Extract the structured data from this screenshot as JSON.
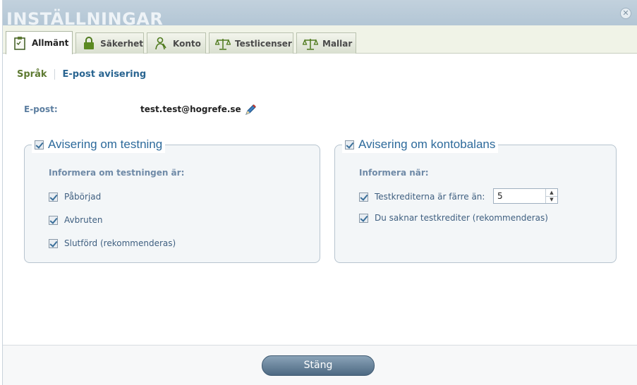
{
  "window": {
    "title": "INSTÄLLNINGAR",
    "close_icon": "close-icon"
  },
  "tabs": [
    {
      "label": "Allmänt",
      "icon": "clipboard-icon",
      "active": true
    },
    {
      "label": "Säkerhet",
      "icon": "lock-icon",
      "active": false
    },
    {
      "label": "Konto",
      "icon": "person-icon",
      "active": false
    },
    {
      "label": "Testlicenser",
      "icon": "scale-icon",
      "active": false
    },
    {
      "label": "Mallar",
      "icon": "scale-icon",
      "active": false
    }
  ],
  "subnav": {
    "items": [
      "Språk",
      "E-post avisering"
    ]
  },
  "email": {
    "label": "E-post:",
    "value": "test.test@hogrefe.se"
  },
  "testing_panel": {
    "title": "Avisering om testning",
    "heading": "Informera om testningen är:",
    "options": [
      {
        "label": "Påbörjad",
        "checked": true
      },
      {
        "label": "Avbruten",
        "checked": true
      },
      {
        "label": "Slutförd (rekommenderas)",
        "checked": true
      }
    ]
  },
  "balance_panel": {
    "title": "Avisering om kontobalans",
    "heading": "Informera när:",
    "credits_label": "Testkrediterna är färre än:",
    "credits_value": "5",
    "no_credits_label": "Du saknar testkrediter (rekommenderas)"
  },
  "footer": {
    "close_label": "Stäng"
  },
  "colors": {
    "accent": "#2d6a9b",
    "green": "#5e7a32",
    "tab_bg": "#f0f3e7"
  }
}
